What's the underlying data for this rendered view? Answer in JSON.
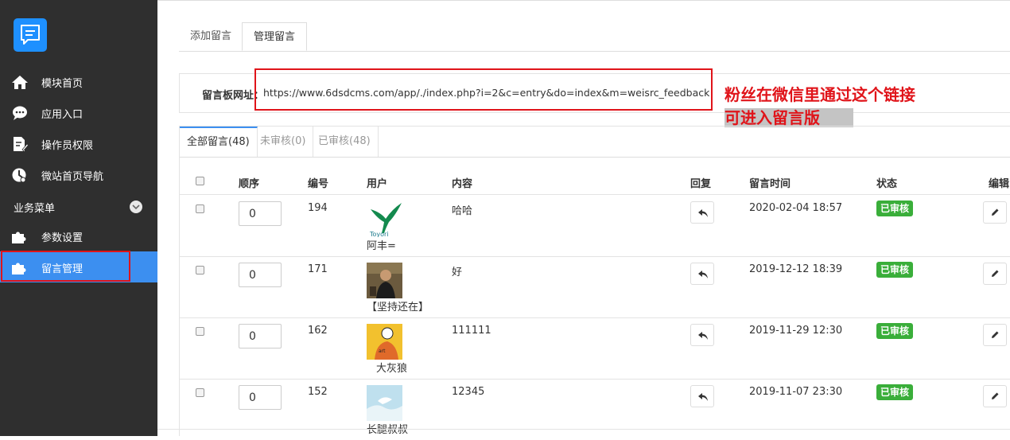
{
  "sidebar": {
    "items": [
      {
        "label": "模块首页",
        "icon": "home-icon"
      },
      {
        "label": "应用入口",
        "icon": "chat-icon"
      },
      {
        "label": "操作员权限",
        "icon": "edit-doc-icon"
      },
      {
        "label": "微站首页导航",
        "icon": "clock-icon"
      }
    ],
    "section_label": "业务菜单",
    "section_items": [
      {
        "label": "参数设置",
        "icon": "puzzle-icon"
      },
      {
        "label": "留言管理",
        "icon": "puzzle-icon"
      }
    ],
    "active_color": "#3c8ff0"
  },
  "tabs": [
    "添加留言",
    "管理留言"
  ],
  "url_panel": {
    "label": "留言板网址：",
    "url": "https://www.6dsdcms.com/app/./index.php?i=2&c=entry&do=index&m=weisrc_feedback"
  },
  "annotation": {
    "line1": "粉丝在微信里通过这个链接",
    "line2": "可进入留言版",
    "color": "#e0141a"
  },
  "filter_tabs": [
    "全部留言(48)",
    "未审核(0)",
    "已审核(48)"
  ],
  "table": {
    "headers": {
      "order": "顺序",
      "id": "编号",
      "user": "用户",
      "content": "内容",
      "reply": "回复",
      "time": "留言时间",
      "status": "状态",
      "edit": "编辑"
    },
    "rows": [
      {
        "order": "0",
        "id": "194",
        "user": "阿丰=",
        "content": "哈哈",
        "time": "2020-02-04 18:57",
        "status": "已审核"
      },
      {
        "order": "0",
        "id": "171",
        "user": "【坚持还在】",
        "content": "好",
        "time": "2019-12-12 18:39",
        "status": "已审核"
      },
      {
        "order": "0",
        "id": "162",
        "user": "大灰狼",
        "content": "111111",
        "time": "2019-11-29 12:30",
        "status": "已审核"
      },
      {
        "order": "0",
        "id": "152",
        "user": "长腿叔叔",
        "content": "12345",
        "time": "2019-11-07 23:30",
        "status": "已审核"
      }
    ],
    "status_color": "#3aae3a"
  }
}
